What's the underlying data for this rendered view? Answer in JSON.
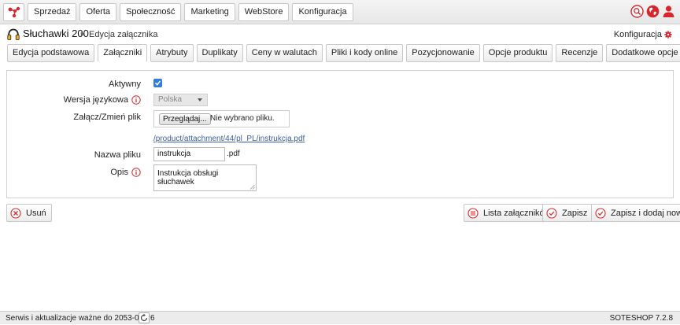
{
  "topmenu": [
    "Sprzedaż",
    "Oferta",
    "Społeczność",
    "Marketing",
    "WebStore",
    "Konfiguracja"
  ],
  "header": {
    "title": "Słuchawki 200",
    "breadcrumb": "Edycja załącznika",
    "config_link": "Konfiguracja"
  },
  "tabs": [
    {
      "label": "Edycja podstawowa",
      "active": false
    },
    {
      "label": "Załączniki",
      "active": true
    },
    {
      "label": "Atrybuty",
      "active": false
    },
    {
      "label": "Duplikaty",
      "active": false
    },
    {
      "label": "Ceny w walutach",
      "active": false
    },
    {
      "label": "Pliki i kody online",
      "active": false
    },
    {
      "label": "Pozycjonowanie",
      "active": false
    },
    {
      "label": "Opcje produktu",
      "active": false
    },
    {
      "label": "Recenzje",
      "active": false
    },
    {
      "label": "Dodatkowe opcje",
      "active": false
    }
  ],
  "form": {
    "active_label": "Aktywny",
    "active_checked": true,
    "language_label": "Wersja językowa",
    "language_value": "Polska",
    "file_label": "Załącz/Zmień plik",
    "browse_button": "Przeglądaj...",
    "no_file_text": "Nie wybrano pliku.",
    "file_link": "/product/attachment/44/pl_PL/instrukcja.pdf",
    "filename_label": "Nazwa pliku",
    "filename_value": "instrukcja",
    "filename_ext": ".pdf",
    "description_label": "Opis",
    "description_value": "Instrukcja obsługi słuchawek"
  },
  "buttons": {
    "delete": "Usuń",
    "list": "Lista załączników",
    "save": "Zapisz",
    "save_new": "Zapisz i dodaj nowy"
  },
  "footer": {
    "service_text": "Serwis i aktualizacje ważne do 2053-08-26",
    "version": "SOTESHOP 7.2.8"
  },
  "colors": {
    "accent_red": "#d9262c",
    "link_blue": "#3a5fa0",
    "checkbox_blue": "#2f7de1"
  }
}
